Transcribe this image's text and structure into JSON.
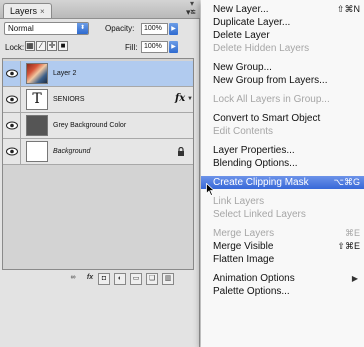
{
  "panel": {
    "tab_label": "Layers",
    "tab_close": "×",
    "collapse_glyph": "▾ ×",
    "menu_glyph": "▾≡",
    "blend_mode": "Normal",
    "opacity_label": "Opacity:",
    "opacity_value": "100%",
    "lock_label": "Lock:",
    "fill_label": "Fill:",
    "fill_value": "100%"
  },
  "layers": [
    {
      "name": "Layer 2",
      "selected": true,
      "thumb": "photo"
    },
    {
      "name": "SENIORS",
      "selected": false,
      "thumb": "text",
      "thumb_text": "T",
      "fx": "fx"
    },
    {
      "name": "Grey Background Color",
      "selected": false,
      "thumb": "grey"
    },
    {
      "name": "Background",
      "selected": false,
      "thumb": "white",
      "locked": true
    }
  ],
  "menu": [
    {
      "label": "New Layer...",
      "shortcut": "⇧⌘N",
      "disabled": false
    },
    {
      "label": "Duplicate Layer...",
      "disabled": false
    },
    {
      "label": "Delete Layer",
      "disabled": false
    },
    {
      "label": "Delete Hidden Layers",
      "disabled": true
    },
    {
      "sep": true
    },
    {
      "label": "New Group...",
      "disabled": false
    },
    {
      "label": "New Group from Layers...",
      "disabled": false
    },
    {
      "sep": true
    },
    {
      "label": "Lock All Layers in Group...",
      "disabled": true
    },
    {
      "sep": true
    },
    {
      "label": "Convert to Smart Object",
      "disabled": false
    },
    {
      "label": "Edit Contents",
      "disabled": true
    },
    {
      "sep": true
    },
    {
      "label": "Layer Properties...",
      "disabled": false
    },
    {
      "label": "Blending Options...",
      "disabled": false
    },
    {
      "sep": true
    },
    {
      "label": "Create Clipping Mask",
      "shortcut": "⌥⌘G",
      "disabled": false,
      "highlight": true
    },
    {
      "sep": true
    },
    {
      "label": "Link Layers",
      "disabled": true
    },
    {
      "label": "Select Linked Layers",
      "disabled": true
    },
    {
      "sep": true
    },
    {
      "label": "Merge Layers",
      "shortcut": "⌘E",
      "disabled": true
    },
    {
      "label": "Merge Visible",
      "shortcut": "⇧⌘E",
      "disabled": false
    },
    {
      "label": "Flatten Image",
      "disabled": false
    },
    {
      "sep": true
    },
    {
      "label": "Animation Options",
      "disabled": false,
      "submenu": true
    },
    {
      "label": "Palette Options...",
      "disabled": false
    }
  ],
  "colors": {
    "selected_row": "#b1cbef",
    "menu_highlight": "#3768d8",
    "disabled_text": "#a6a6a6"
  }
}
